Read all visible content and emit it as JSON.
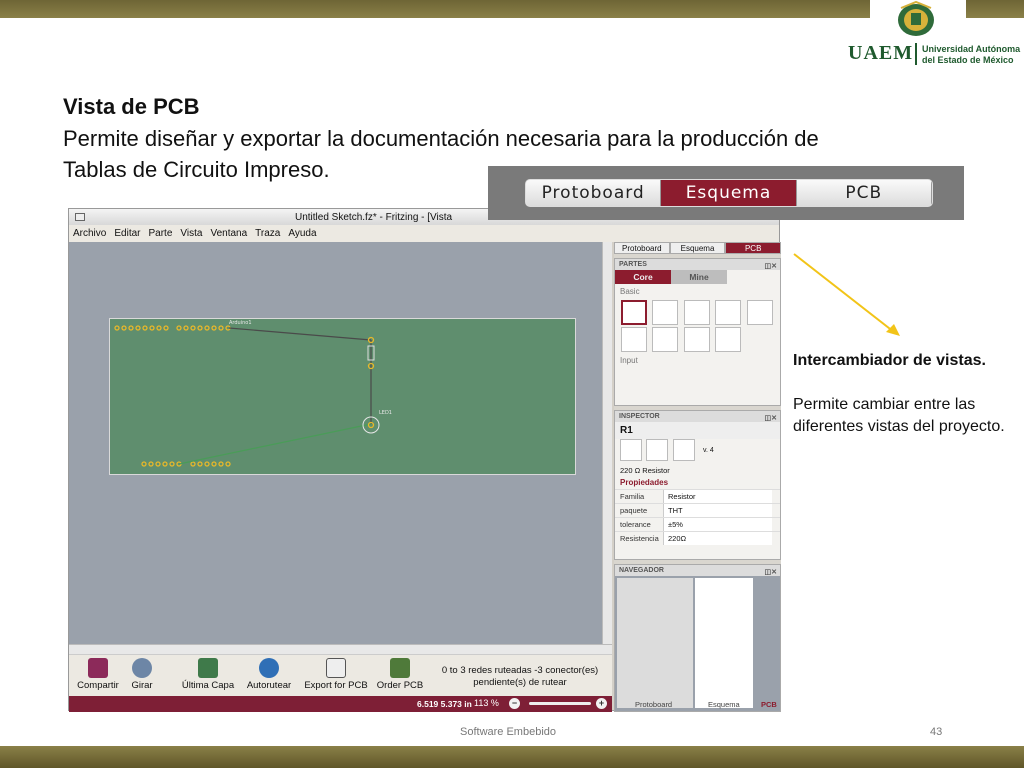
{
  "slide": {
    "title": "Vista de PCB",
    "body": "Permite diseñar y exportar la documentación necesaria para la producción de Tablas de Circuito Impreso.",
    "footer": "Software Embebido",
    "page_number": "43"
  },
  "logo": {
    "acronym": "UAEM",
    "university_line1": "Universidad Autónoma",
    "university_line2": "del Estado de México"
  },
  "zoom_tabs": [
    "Protoboard",
    "Esquema",
    "PCB"
  ],
  "zoom_tabs_active": "Esquema",
  "app": {
    "window_title": "Untitled Sketch.fz* - Fritzing - [Vista",
    "menus": [
      "Archivo",
      "Editar",
      "Parte",
      "Vista",
      "Ventana",
      "Traza",
      "Ayuda"
    ],
    "board_labels": {
      "arduino": "Arduino1",
      "led": "LED1"
    },
    "toolbar": {
      "share": "Compartir",
      "rotate": "Girar",
      "last_layer": "Última Capa",
      "autoroute": "Autorutear",
      "export_pcb": "Export for PCB",
      "order_pcb": "Order PCB",
      "routing_status": "0 to 3 redes ruteadas -3 conector(es) pendiente(s) de rutear"
    },
    "status": {
      "coords": "6.519 5.373 in",
      "zoom": "113 %"
    },
    "dock": {
      "view_tabs": [
        "Protoboard",
        "Esquema",
        "PCB"
      ],
      "active_view": "PCB",
      "parts": {
        "header": "PARTES",
        "tabs": [
          "Core",
          "Mine"
        ],
        "section_basic": "Basic",
        "section_input": "Input"
      },
      "inspector": {
        "header": "INSPECTOR",
        "part_title": "R1",
        "version": "v. 4",
        "description": "220 Ω Resistor",
        "props_header": "Propiedades",
        "props": [
          {
            "key": "Familia",
            "value": "Resistor"
          },
          {
            "key": "paquete",
            "value": "THT"
          },
          {
            "key": "tolerance",
            "value": "±5%"
          },
          {
            "key": "Resistencia",
            "value": "220Ω"
          }
        ]
      },
      "navigator": {
        "header": "NAVEGADOR",
        "labels": [
          "Protoboard",
          "Esquema",
          "PCB"
        ]
      }
    }
  },
  "annotation": {
    "title": "Intercambiador de vistas.",
    "body": "Permite cambiar entre las diferentes vistas del proyecto."
  },
  "colors": {
    "accent": "#8c1c2e",
    "pcb_green": "#5f8e6e",
    "canvas": "#9aa1ab",
    "olive_bar": "#7a7040",
    "arrow": "#f2c418"
  }
}
